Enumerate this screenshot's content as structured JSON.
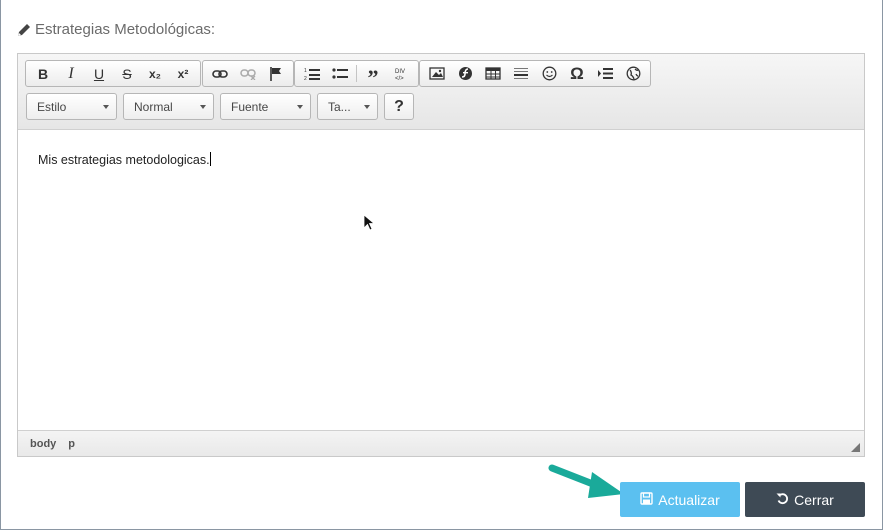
{
  "field": {
    "label": "Estrategias Metodológicas:"
  },
  "toolbar": {
    "row1": [
      {
        "icon": "bold-icon",
        "glyph": "B"
      },
      {
        "icon": "italic-icon",
        "glyph": "I"
      },
      {
        "icon": "underline-icon",
        "glyph": "U"
      },
      {
        "icon": "strikethrough-icon",
        "glyph": "S"
      },
      {
        "icon": "subscript-icon",
        "glyph": "x₂"
      },
      {
        "icon": "superscript-icon",
        "glyph": "x²"
      }
    ],
    "combos": {
      "style": "Estilo",
      "format": "Normal",
      "font": "Fuente",
      "size": "Ta..."
    },
    "help": "?"
  },
  "editor": {
    "content": "Mis estrategias metodologicas."
  },
  "statusbar": {
    "path": [
      "body",
      "p"
    ]
  },
  "buttons": {
    "update": "Actualizar",
    "close": "Cerrar"
  },
  "colors": {
    "primary": "#5bc0f0",
    "dark": "#3e4a55",
    "annotation_arrow": "#1aaa9a"
  }
}
